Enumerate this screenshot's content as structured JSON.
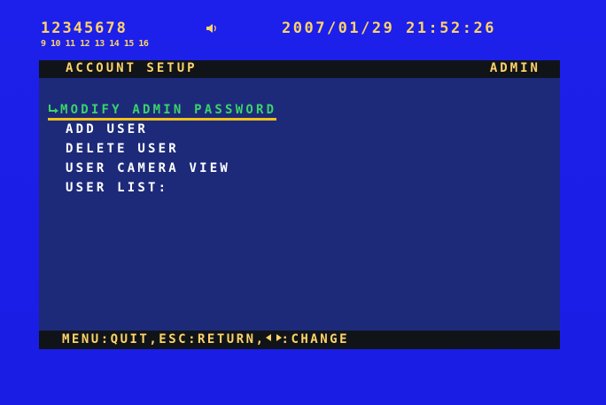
{
  "status": {
    "camera_row_1": "12345678",
    "camera_row_2": "9 10 11 12 13 14 15 16",
    "audio_icon": "speaker-icon",
    "datetime": "2007/01/29  21:52:26"
  },
  "header": {
    "title": "ACCOUNT SETUP",
    "user": "ADMIN"
  },
  "menu": {
    "items": [
      {
        "label": "MODIFY ADMIN PASSWORD",
        "selected": true
      },
      {
        "label": "ADD USER"
      },
      {
        "label": "DELETE USER"
      },
      {
        "label": "USER CAMERA VIEW"
      },
      {
        "label": "USER LIST:"
      }
    ]
  },
  "footer": {
    "hint_prefix": "MENU:QUIT,ESC:RETURN,",
    "hint_suffix": ":CHANGE",
    "arrows_icon": "left-right-arrows-icon"
  },
  "colors": {
    "background": "#1a1ee8",
    "panel": "#1d2a7a",
    "bar": "#101418",
    "text_yellow": "#ffd36a",
    "selected_green": "#3ad46a",
    "underline": "#f2c21a"
  }
}
